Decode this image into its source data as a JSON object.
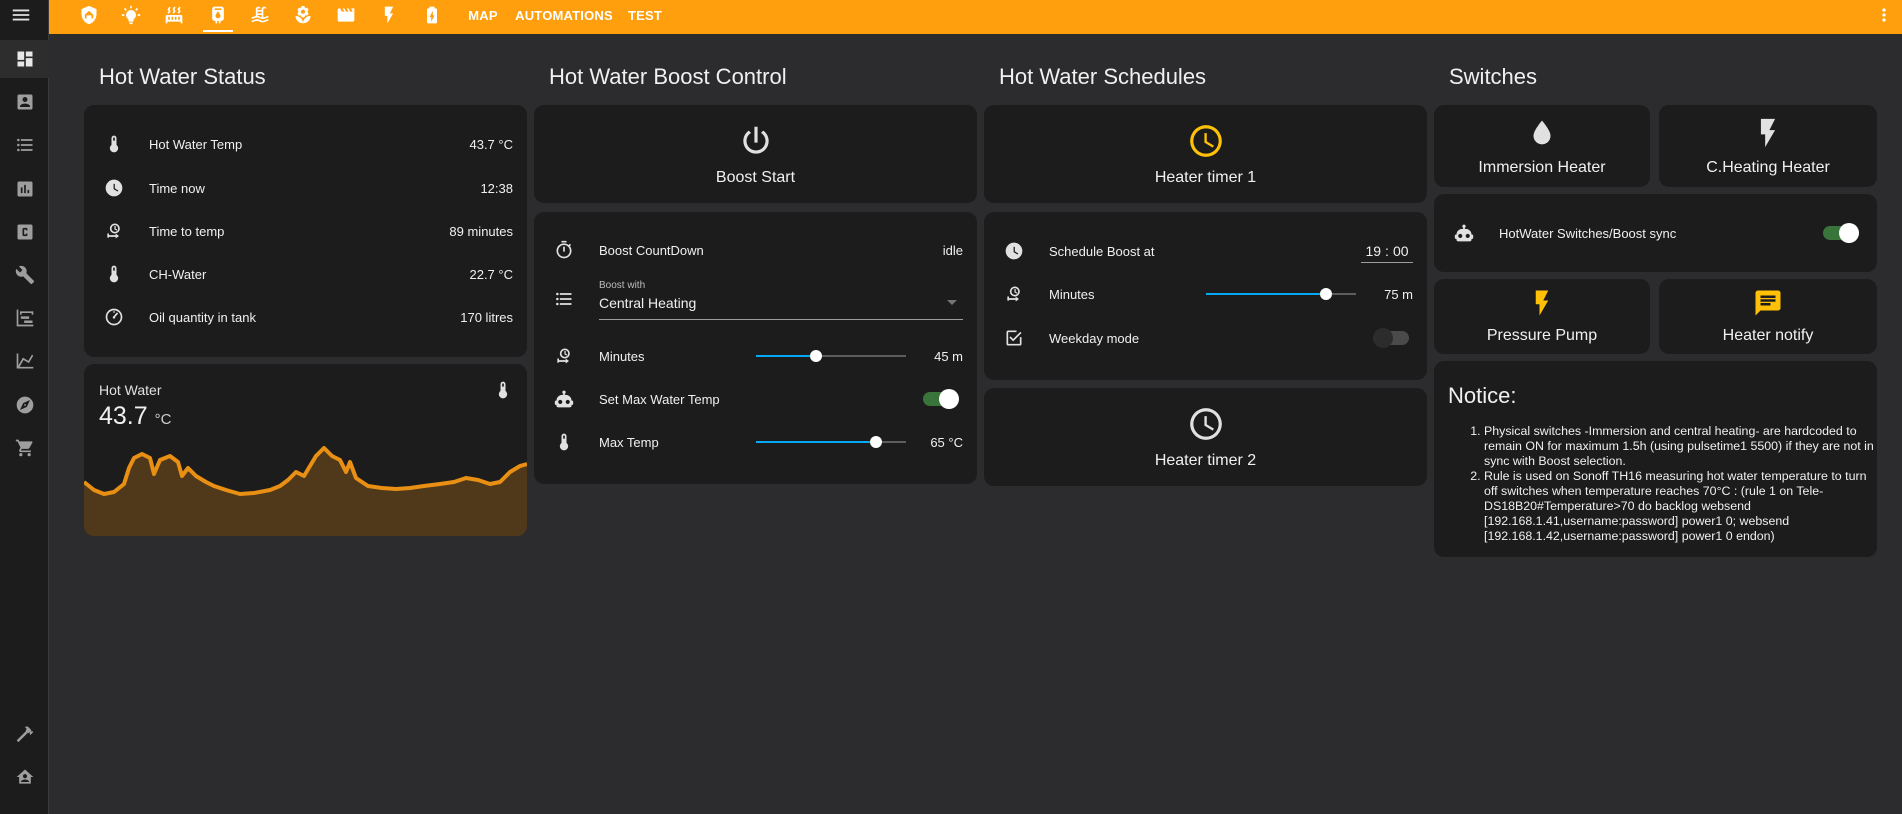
{
  "colors": {
    "accent": "#ff9f0e",
    "card": "#1c1c1c",
    "slider": "#03a9f4",
    "toggle_on": "#4caf50",
    "timer_icon": "#ffc107"
  },
  "topbar": {
    "tabs": [
      "MAP",
      "AUTOMATIONS",
      "TEST"
    ],
    "icons": [
      "shield-home-icon",
      "lightbulb-icon",
      "radiator-icon",
      "water-boiler-icon",
      "pool-icon",
      "flower-icon",
      "movie-clapper-icon",
      "flash-icon",
      "battery-charging-icon"
    ]
  },
  "sidebar": {
    "items": [
      "view-dashboard-icon",
      "account-box-icon",
      "format-list-bulleted-icon",
      "chart-box-icon",
      "alpha-c-box-icon",
      "wrench-icon",
      "chart-timeline-icon",
      "chart-line-icon",
      "compass-icon",
      "cart-icon",
      "hammer-icon",
      "home-assistant-icon"
    ]
  },
  "status": {
    "title": "Hot Water Status",
    "rows": [
      {
        "label": "Hot Water Temp",
        "value": "43.7 °C"
      },
      {
        "label": "Time now",
        "value": "12:38"
      },
      {
        "label": "Time to temp",
        "value": "89 minutes"
      },
      {
        "label": "CH-Water",
        "value": "22.7 °C"
      },
      {
        "label": "Oil quantity in tank",
        "value": "170 litres"
      }
    ],
    "graph": {
      "label": "Hot Water",
      "value": "43.7",
      "unit": "°C"
    }
  },
  "boost": {
    "title": "Hot Water Boost Control",
    "start_label": "Boost Start",
    "countdown_label": "Boost CountDown",
    "countdown_value": "idle",
    "boost_with_label": "Boost with",
    "boost_with_value": "Central Heating",
    "minutes_label": "Minutes",
    "minutes_value": "45 m",
    "minutes_fraction": 0.4,
    "set_max_label": "Set Max Water Temp",
    "set_max_on": true,
    "max_temp_label": "Max Temp",
    "max_temp_value": "65 °C",
    "max_temp_fraction": 0.8
  },
  "schedules": {
    "title": "Hot Water Schedules",
    "timer1_label": "Heater timer 1",
    "schedule_boost_label": "Schedule Boost at",
    "schedule_boost_hour": "19",
    "schedule_boost_min": "00",
    "minutes_label": "Minutes",
    "minutes_value": "75 m",
    "minutes_fraction": 0.8,
    "weekday_label": "Weekday mode",
    "weekday_on": false,
    "timer2_label": "Heater timer 2"
  },
  "switches": {
    "title": "Switches",
    "immersion_label": "Immersion Heater",
    "ch_label": "C.Heating Heater",
    "sync_label": "HotWater Switches/Boost sync",
    "sync_on": true,
    "pump_label": "Pressure Pump",
    "notify_label": "Heater notify"
  },
  "notice": {
    "title": "Notice:",
    "items": [
      "Physical switches -Immersion and central heating- are hardcoded to remain ON for maximum 1.5h (using pulsetime1 5500) if they are not in sync with Boost selection.",
      "Rule is used on Sonoff TH16 measuring hot water temperature to turn off switches when temperature reaches 70°C : (rule 1 on Tele-DS18B20#Temperature>70 do backlog websend [192.168.1.41,username:password] power1 0; websend [192.168.1.42,username:password] power1 0 endon)"
    ]
  }
}
